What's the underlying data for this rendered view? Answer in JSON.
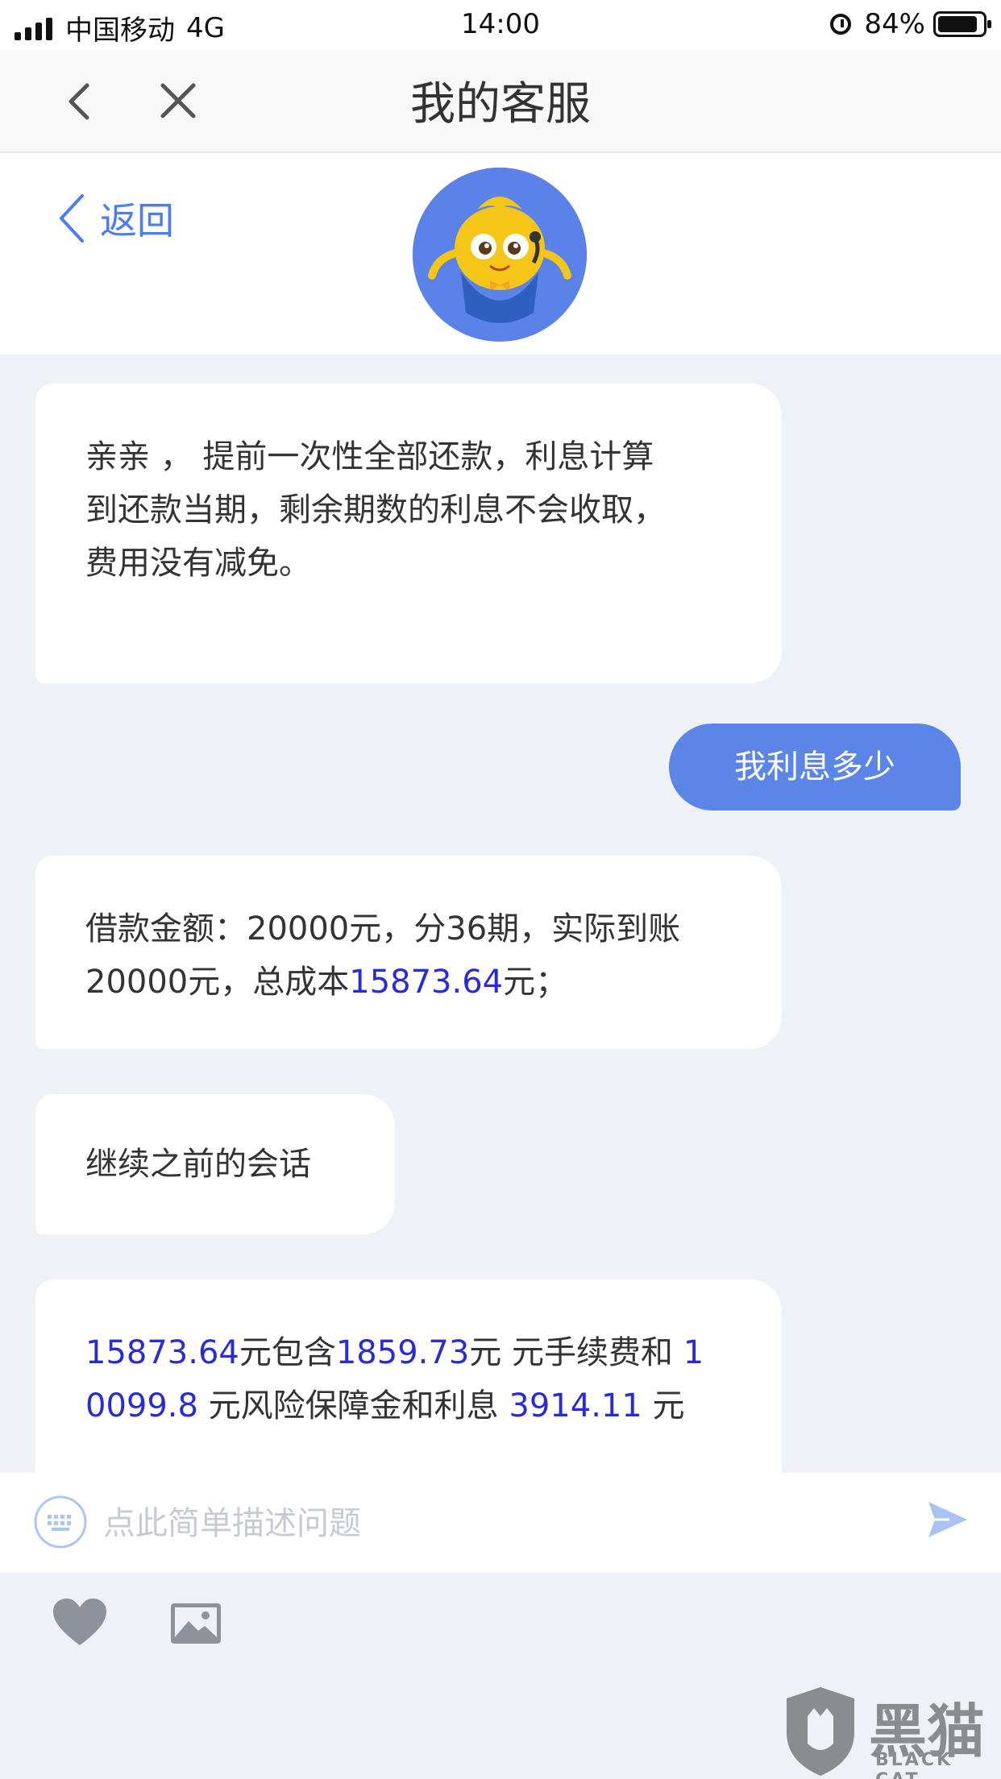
{
  "status_bar": {
    "carrier": "中国移动",
    "network": "4G",
    "time": "14:00",
    "battery": "84%"
  },
  "nav": {
    "title": "我的客服"
  },
  "header": {
    "back_label": "返回"
  },
  "messages": {
    "m1": {
      "line1": "亲亲 ， 提前一次性全部还款，利息计算",
      "line2": "到还款当期，剩余期数的利息不会收取，",
      "line3": "费用没有减免。"
    },
    "user1": "我利息多少",
    "m2": {
      "line1": "借款金额：20000元，分36期，实际到账",
      "line2_a": "20000元，总成本",
      "line2_b": "15873.64",
      "line2_c": "元；"
    },
    "m3": "继续之前的会话",
    "m4": {
      "a": "15873.64",
      "b": "元包含",
      "c": "1859.73",
      "d": "元 元手续费和 ",
      "e": "1",
      "f": "0099.8",
      "g": " 元风险保障金和利息 ",
      "h": "3914.11",
      "i": " 元"
    }
  },
  "input": {
    "placeholder": "点此简单描述问题"
  },
  "watermark": {
    "title": "黑猫",
    "subtitle": "BLACK CAT"
  },
  "colors": {
    "accent": "#5b85e6",
    "highlight": "#2a2ad8",
    "link": "#4d7cf0"
  }
}
